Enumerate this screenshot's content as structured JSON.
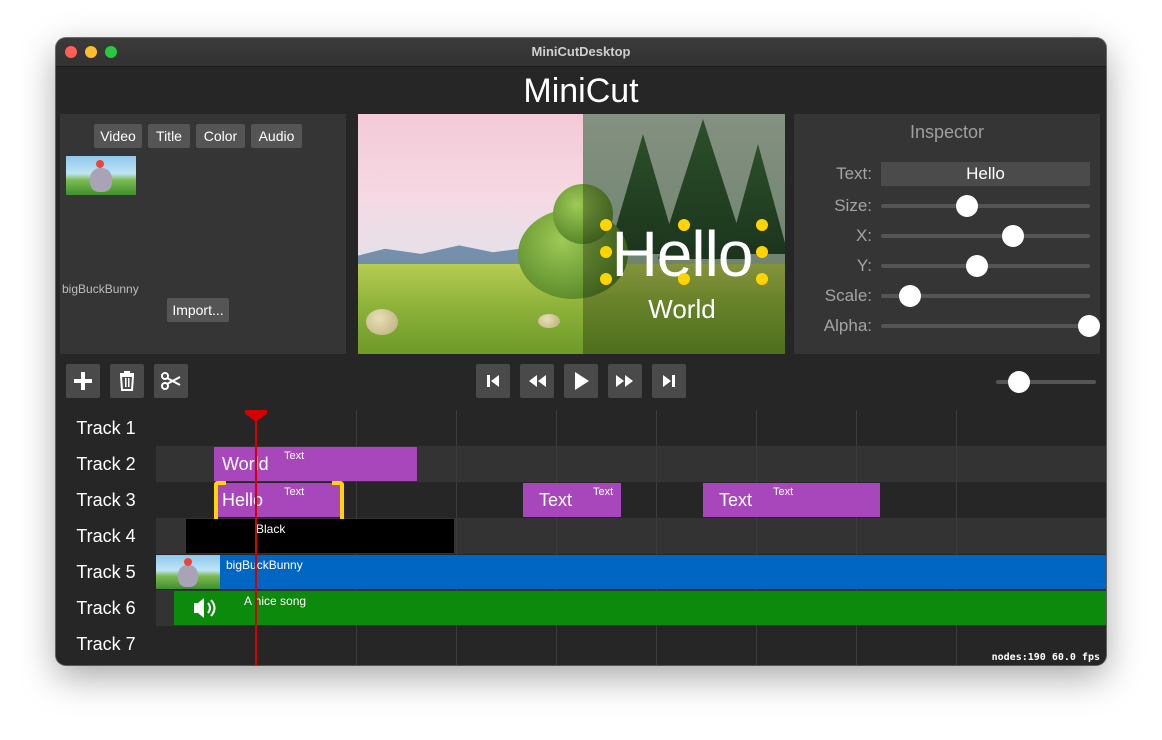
{
  "window": {
    "title": "MiniCutDesktop"
  },
  "app": {
    "title": "MiniCut"
  },
  "media": {
    "tabs": [
      "Video",
      "Title",
      "Color",
      "Audio"
    ],
    "items": [
      {
        "name": "bigBuckBunny",
        "icon": "video-thumbnail-icon"
      }
    ],
    "import_label": "Import..."
  },
  "preview": {
    "title_text": "Hello",
    "subtitle_text": "World"
  },
  "inspector": {
    "title": "Inspector",
    "text_label": "Text:",
    "text_value": "Hello",
    "sliders": [
      {
        "label": "Size:",
        "value": 0.41
      },
      {
        "label": "X:",
        "value": 0.63
      },
      {
        "label": "Y:",
        "value": 0.46
      },
      {
        "label": "Scale:",
        "value": 0.14
      },
      {
        "label": "Alpha:",
        "value": 1.0
      }
    ]
  },
  "toolbar": {
    "edit_icons": [
      "add-icon",
      "delete-icon",
      "cut-icon"
    ],
    "transport_icons": [
      "skip-to-start-icon",
      "rewind-icon",
      "play-icon",
      "fast-forward-icon",
      "skip-to-end-icon"
    ],
    "zoom_value": 0.23
  },
  "timeline": {
    "tracks": [
      "Track 1",
      "Track 2",
      "Track 3",
      "Track 4",
      "Track 5",
      "Track 6",
      "Track 7"
    ],
    "clips": {
      "track2_world": {
        "big": "World",
        "small": "Text"
      },
      "track3_hello": {
        "big": "Hello",
        "small": "Text",
        "selected": true
      },
      "track3_text1": {
        "big": "Text",
        "small": "Text"
      },
      "track3_text2": {
        "big": "Text",
        "small": "Text"
      },
      "track4_black": {
        "label": "Black"
      },
      "track5_video": {
        "label": "bigBuckBunny"
      },
      "track6_audio": {
        "label": "A nice song",
        "icon": "speaker-icon"
      }
    },
    "stats": "nodes:190  60.0 fps"
  },
  "colors": {
    "text_clip": "#a847bb",
    "video_clip": "#0066c4",
    "audio_clip": "#0b8a0b",
    "playhead": "#d60000",
    "selection": "#ffd400"
  }
}
